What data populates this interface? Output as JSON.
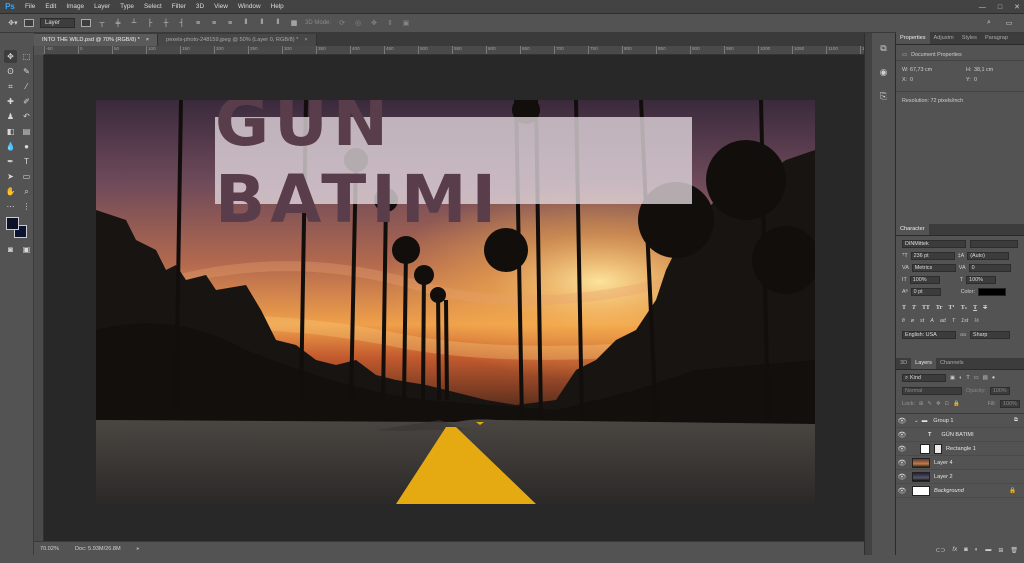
{
  "app": {
    "logo": "Ps"
  },
  "menu": [
    "File",
    "Edit",
    "Image",
    "Layer",
    "Type",
    "Select",
    "Filter",
    "3D",
    "View",
    "Window",
    "Help"
  ],
  "window_controls": [
    "—",
    "□",
    "✕"
  ],
  "options_bar": {
    "auto_select_label": "Layer",
    "mode_3d": "3D Mode:"
  },
  "tabs": [
    {
      "label": "INTO THE WILD.psd @ 70% (RGB/8) *",
      "close": "×"
    },
    {
      "label": "pexels-photo-248159.jpeg @ 50% (Layer 0, RGB/8) *",
      "close": "×"
    }
  ],
  "ruler_ticks": [
    "-50",
    "0",
    "50",
    "100",
    "150",
    "200",
    "250",
    "300",
    "350",
    "400",
    "450",
    "500",
    "550",
    "600",
    "650",
    "700",
    "750",
    "800",
    "850",
    "900",
    "950",
    "1000",
    "1050",
    "1100",
    "1150"
  ],
  "canvas": {
    "headline": "GÜN BATIMI"
  },
  "status": {
    "zoom": "70.02%",
    "doc": "Doc: 5.93M/26.8M"
  },
  "properties": {
    "tabs": [
      "Properties",
      "Adjustm",
      "Styles",
      "Paragrap"
    ],
    "section": "Document Properties",
    "w_label": "W:",
    "w_value": "67,73 cm",
    "h_label": "H:",
    "h_value": "38,1 cm",
    "x_label": "X:",
    "x_value": "0",
    "y_label": "Y:",
    "y_value": "0",
    "resolution": "Resolution: 72 pixels/inch"
  },
  "character": {
    "tab": "Character",
    "font_family": "DINMittek",
    "font_size": "236 pt",
    "leading": "(Auto)",
    "kerning": "Metrics",
    "tracking": "0",
    "vert_scale": "100%",
    "horiz_scale": "100%",
    "baseline": "0 pt",
    "color_label": "Color:",
    "language": "English: USA",
    "aa_mark": "aa",
    "antialias": "Sharp",
    "type_buttons": [
      "T",
      "T",
      "TT",
      "Tr",
      "T¹",
      "T₁",
      "T",
      "T"
    ],
    "glyph_buttons": [
      "fi",
      "ø",
      "st",
      "A",
      "ad",
      "T",
      "1st",
      "½"
    ]
  },
  "layers_panel": {
    "tabs": [
      "3D",
      "Layers",
      "Channels"
    ],
    "filter": "Kind",
    "blend": "Normal",
    "opacity_label": "Opacity:",
    "opacity": "100%",
    "lock_label": "Lock:",
    "fill_label": "Fill:",
    "fill": "100%",
    "layers": [
      {
        "name": "Group 1",
        "kind": "group"
      },
      {
        "name": "GÜN BATIMI",
        "kind": "text"
      },
      {
        "name": "Rectangle 1",
        "kind": "shape"
      },
      {
        "name": "Layer 4",
        "kind": "image"
      },
      {
        "name": "Layer 2",
        "kind": "image"
      },
      {
        "name": "Background",
        "kind": "background"
      }
    ],
    "footer_icons": [
      "link-icon",
      "fx-icon",
      "mask-icon",
      "adjustment-icon",
      "folder-icon",
      "new-layer-icon",
      "trash-icon"
    ]
  },
  "colors": {
    "foreground": "#0e1228",
    "background": "#ffffff",
    "text_color": "#000000",
    "headline_color": "#5a3d4a",
    "accent": "#31a8ff"
  }
}
